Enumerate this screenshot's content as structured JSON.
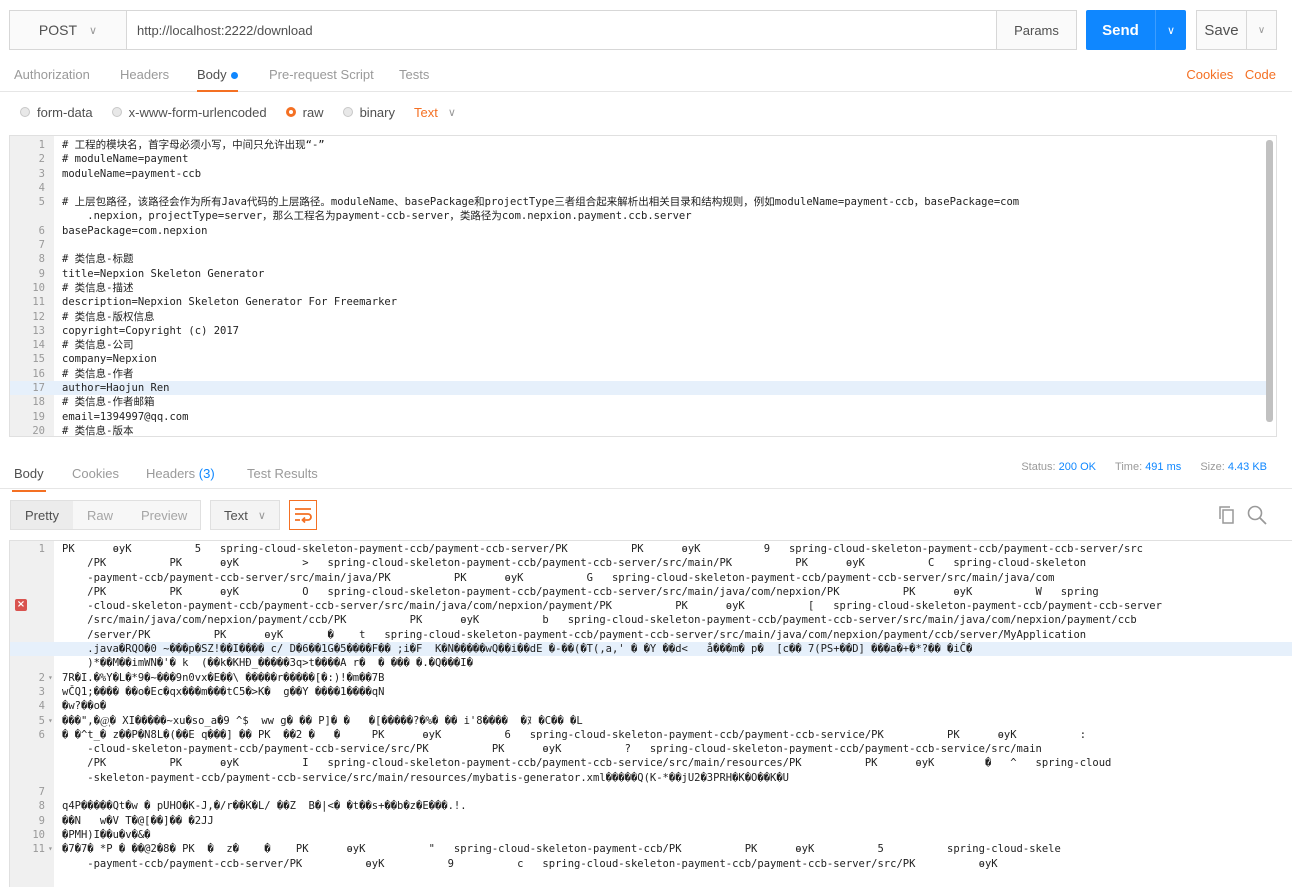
{
  "request": {
    "method": "POST",
    "url": "http://localhost:2222/download",
    "params_label": "Params",
    "send_label": "Send",
    "save_label": "Save"
  },
  "request_tabs": {
    "authorization": "Authorization",
    "headers": "Headers",
    "body": "Body",
    "prerequest": "Pre-request Script",
    "tests": "Tests",
    "cookies": "Cookies",
    "code": "Code"
  },
  "body_modes": {
    "form_data": "form-data",
    "urlencoded": "x-www-form-urlencoded",
    "raw": "raw",
    "binary": "binary",
    "text_type": "Text"
  },
  "request_body": [
    {
      "n": "1",
      "t": "# 工程的模块名，首字母必须小写，中间只允许出现“-”"
    },
    {
      "n": "2",
      "t": "# moduleName=payment"
    },
    {
      "n": "3",
      "t": "moduleName=payment-ccb"
    },
    {
      "n": "4",
      "t": ""
    },
    {
      "n": "5",
      "t": "# 上层包路径，该路径会作为所有Java代码的上层路径。moduleName、basePackage和projectType三者组合起来解析出相关目录和结构规则，例如moduleName=payment-ccb，basePackage=com"
    },
    {
      "n": "",
      "t": "    .nepxion，projectType=server，那么工程名为payment-ccb-server，类路径为com.nepxion.payment.ccb.server"
    },
    {
      "n": "6",
      "t": "basePackage=com.nepxion"
    },
    {
      "n": "7",
      "t": ""
    },
    {
      "n": "8",
      "t": "# 类信息-标题"
    },
    {
      "n": "9",
      "t": "title=Nepxion Skeleton Generator"
    },
    {
      "n": "10",
      "t": "# 类信息-描述"
    },
    {
      "n": "11",
      "t": "description=Nepxion Skeleton Generator For Freemarker"
    },
    {
      "n": "12",
      "t": "# 类信息-版权信息"
    },
    {
      "n": "13",
      "t": "copyright=Copyright (c) 2017"
    },
    {
      "n": "14",
      "t": "# 类信息-公司"
    },
    {
      "n": "15",
      "t": "company=Nepxion"
    },
    {
      "n": "16",
      "t": "# 类信息-作者"
    },
    {
      "n": "17",
      "t": "author=Haojun Ren"
    },
    {
      "n": "18",
      "t": "# 类信息-作者邮箱"
    },
    {
      "n": "19",
      "t": "email=1394997@qq.com"
    },
    {
      "n": "20",
      "t": "# 类信息-版本"
    }
  ],
  "response_tabs": {
    "body": "Body",
    "cookies": "Cookies",
    "headers": "Headers",
    "headers_count": "(3)",
    "test_results": "Test Results"
  },
  "status": {
    "status_label": "Status:",
    "status_value": "200 OK",
    "time_label": "Time:",
    "time_value": "491 ms",
    "size_label": "Size:",
    "size_value": "4.43 KB"
  },
  "view_modes": {
    "pretty": "Pretty",
    "raw": "Raw",
    "preview": "Preview",
    "format": "Text"
  },
  "response_body": [
    {
      "n": "1",
      "t": "PK      ѳyK          5   spring-cloud-skeleton-payment-ccb/payment-ccb-server/PK          PK      ѳyK          9   spring-cloud-skeleton-payment-ccb/payment-ccb-server/src"
    },
    {
      "n": "",
      "t": "    /PK          PK      ѳyK          >   spring-cloud-skeleton-payment-ccb/payment-ccb-server/src/main/PK          PK      ѳyK          C   spring-cloud-skeleton"
    },
    {
      "n": "",
      "t": "    -payment-ccb/payment-ccb-server/src/main/java/PK          PK      ѳyK          G   spring-cloud-skeleton-payment-ccb/payment-ccb-server/src/main/java/com"
    },
    {
      "n": "",
      "t": "    /PK          PK      ѳyK          O   spring-cloud-skeleton-payment-ccb/payment-ccb-server/src/main/java/com/nepxion/PK          PK      ѳyK          W   spring"
    },
    {
      "n": "",
      "t": "    -cloud-skeleton-payment-ccb/payment-ccb-server/src/main/java/com/nepxion/payment/PK          PK      ѳyK          [   spring-cloud-skeleton-payment-ccb/payment-ccb-server"
    },
    {
      "n": "",
      "t": "    /src/main/java/com/nepxion/payment/ccb/PK          PK      ѳyK          b   spring-cloud-skeleton-payment-ccb/payment-ccb-server/src/main/java/com/nepxion/payment/ccb"
    },
    {
      "n": "",
      "t": "    /server/PK          PK      ѳyK       �    t   spring-cloud-skeleton-payment-ccb/payment-ccb-server/src/main/java/com/nepxion/payment/ccb/server/MyApplication"
    },
    {
      "n": "",
      "t": "    .java�RQO�0 ~���p�SZ!��I���� c/ D�6��1G�5����F�� ;i�F  K�N�����wQ��i��dE �-��(�T(,a,' � �Y ��d<   å���m� p�  [c�� 7(PS+��D] ���a�+�*?�� �iĈ�"
    },
    {
      "n": "",
      "t": "    )*��M��imWN�'� k  (��k�KHÐ_�����3q>t����A r�  � ��� �.�Q���I�"
    },
    {
      "n": "2",
      "t": "7R�I.�%Y�L�*9�~���9n0vx�E��\\ �����r�����[�:)!�m��7B"
    },
    {
      "n": "3",
      "t": "wČQ1;���� ��o�Ec�qx���m���tC5�>K�  g��Y ����1����qN"
    },
    {
      "n": "4",
      "t": "�w?��o�"
    },
    {
      "n": "5",
      "t": "���\",�@ͅ� XI�����~xu�so_a�9 ^$  ww g� �� P]� �   �[�����?�%� �� i'8����  �ﾇ �C�� �L"
    },
    {
      "n": "6",
      "t": "� �^t_� z��P�N8L�(��E q���] �� PK  ��2 �   �     PK      ѳyK          6   spring-cloud-skeleton-payment-ccb/payment-ccb-service/PK          PK      ѳyK          :"
    },
    {
      "n": "",
      "t": "    -cloud-skeleton-payment-ccb/payment-ccb-service/src/PK          PK      ѳyK          ?   spring-cloud-skeleton-payment-ccb/payment-ccb-service/src/main"
    },
    {
      "n": "",
      "t": "    /PK          PK      ѳyK          I   spring-cloud-skeleton-payment-ccb/payment-ccb-service/src/main/resources/PK          PK      ѳyK        �   ^   spring-cloud"
    },
    {
      "n": "",
      "t": "    -skeleton-payment-ccb/payment-ccb-service/src/main/resources/mybatis-generator.xml�����Q(K-*��jU2�3PRH�K�O��K�U"
    },
    {
      "n": "7",
      "t": ""
    },
    {
      "n": "8",
      "t": "q4P�����Qt�w � pUHO�K-J,�/r��K�L/ ��Z  B�|<� �t��s+��b�z�E���.!."
    },
    {
      "n": "9",
      "t": "��N   w�V T�@[��]�� �2JJ"
    },
    {
      "n": "10",
      "t": "�PMH)I��u�v�&�"
    },
    {
      "n": "11",
      "t": "�7�7� *P � ��@2�8� PK  �  z�    �    PK      ѳyK          \"   spring-cloud-skeleton-payment-ccb/PK          PK      ѳyK          5          spring-cloud-skele"
    },
    {
      "n": "",
      "t": "    -payment-ccb/payment-ccb-server/PK          ѳyK          9          c   spring-cloud-skeleton-payment-ccb/payment-ccb-server/src/PK          ѳyK"
    }
  ]
}
